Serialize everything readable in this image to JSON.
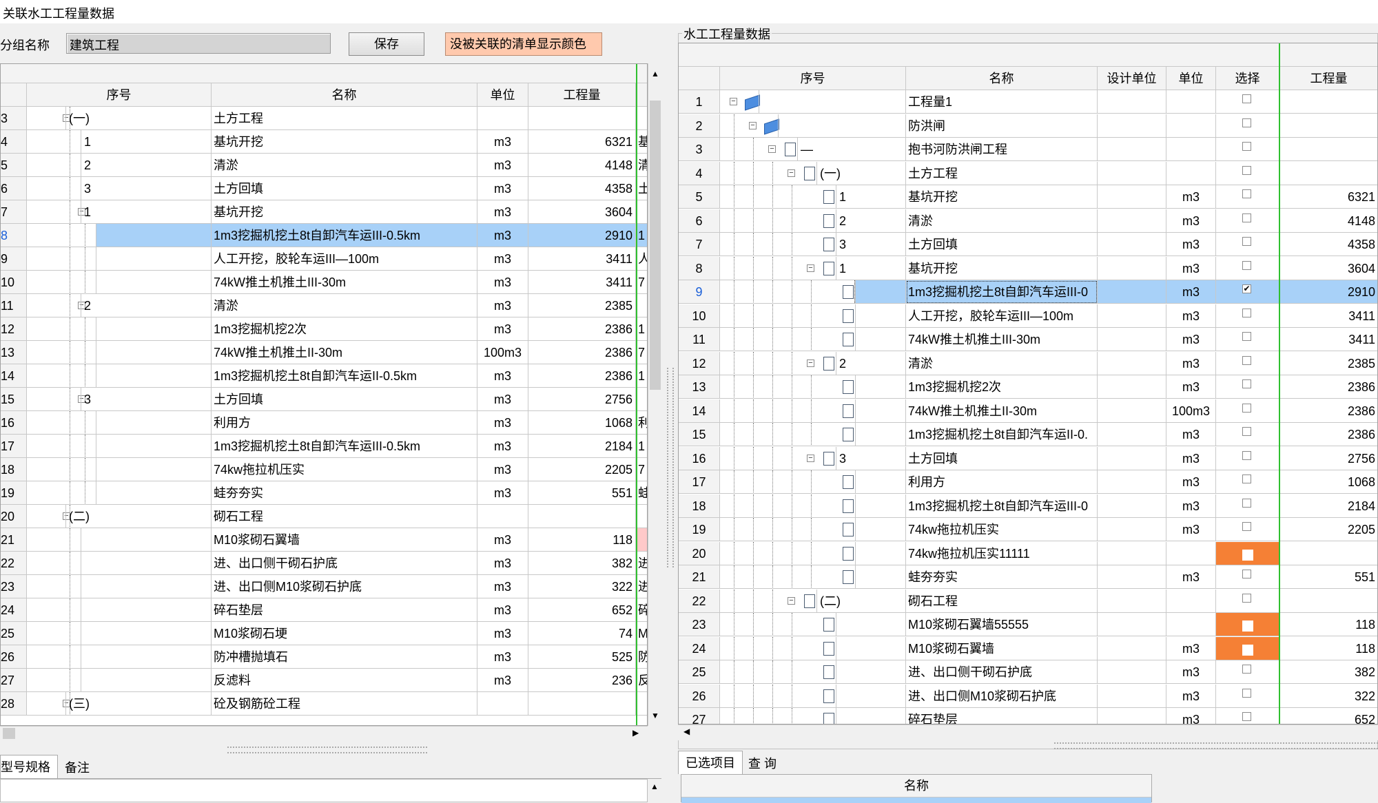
{
  "title": "关联水工工程量数据",
  "left_panel": {
    "group_label": "分组名称",
    "group_value": "建筑工程",
    "save_label": "保存",
    "color_label": "没被关联的清单显示颜色",
    "columns": [
      "序号",
      "名称",
      "单位",
      "工程量"
    ],
    "rows": [
      {
        "n": "3",
        "seq": "(一)",
        "name": "土方工程",
        "unit": "",
        "qty": "",
        "extra": "",
        "lvl": 0,
        "tog": true
      },
      {
        "n": "4",
        "seq": "1",
        "name": "基坑开挖",
        "unit": "m3",
        "qty": "6321",
        "extra": "基",
        "lvl": 1
      },
      {
        "n": "5",
        "seq": "2",
        "name": "清淤",
        "unit": "m3",
        "qty": "4148",
        "extra": "清",
        "lvl": 1
      },
      {
        "n": "6",
        "seq": "3",
        "name": "土方回填",
        "unit": "m3",
        "qty": "4358",
        "extra": "土",
        "lvl": 1
      },
      {
        "n": "7",
        "seq": "1",
        "name": "基坑开挖",
        "unit": "m3",
        "qty": "3604",
        "extra": "",
        "lvl": 1,
        "tog": true
      },
      {
        "n": "8",
        "seq": "",
        "name": "1m3挖掘机挖土8t自卸汽车运III-0.5km",
        "unit": "m3",
        "qty": "2910",
        "extra": "1",
        "lvl": 2,
        "selected": true
      },
      {
        "n": "9",
        "seq": "",
        "name": "人工开挖，胶轮车运III—100m",
        "unit": "m3",
        "qty": "3411",
        "extra": "人",
        "lvl": 2
      },
      {
        "n": "10",
        "seq": "",
        "name": "74kW推土机推土III-30m",
        "unit": "m3",
        "qty": "3411",
        "extra": "7",
        "lvl": 2
      },
      {
        "n": "11",
        "seq": "2",
        "name": "清淤",
        "unit": "m3",
        "qty": "2385",
        "extra": "",
        "lvl": 1,
        "tog": true
      },
      {
        "n": "12",
        "seq": "",
        "name": "1m3挖掘机挖2次",
        "unit": "m3",
        "qty": "2386",
        "extra": "1",
        "lvl": 2
      },
      {
        "n": "13",
        "seq": "",
        "name": "74kW推土机推土II-30m",
        "unit": "100m3",
        "qty": "2386",
        "extra": "7",
        "lvl": 2
      },
      {
        "n": "14",
        "seq": "",
        "name": "1m3挖掘机挖土8t自卸汽车运II-0.5km",
        "unit": "m3",
        "qty": "2386",
        "extra": "1",
        "lvl": 2
      },
      {
        "n": "15",
        "seq": "3",
        "name": "土方回填",
        "unit": "m3",
        "qty": "2756",
        "extra": "",
        "lvl": 1,
        "tog": true
      },
      {
        "n": "16",
        "seq": "",
        "name": "利用方",
        "unit": "m3",
        "qty": "1068",
        "extra": "利",
        "lvl": 2
      },
      {
        "n": "17",
        "seq": "",
        "name": "1m3挖掘机挖土8t自卸汽车运III-0.5km",
        "unit": "m3",
        "qty": "2184",
        "extra": "1",
        "lvl": 2
      },
      {
        "n": "18",
        "seq": "",
        "name": "74kw拖拉机压实",
        "unit": "m3",
        "qty": "2205",
        "extra": "7",
        "lvl": 2
      },
      {
        "n": "19",
        "seq": "",
        "name": "蛙夯夯实",
        "unit": "m3",
        "qty": "551",
        "extra": "蛙",
        "lvl": 2
      },
      {
        "n": "20",
        "seq": "(二)",
        "name": "砌石工程",
        "unit": "",
        "qty": "",
        "extra": "",
        "lvl": 0,
        "tog": true
      },
      {
        "n": "21",
        "seq": "",
        "name": "M10浆砌石翼墙",
        "unit": "m3",
        "qty": "118",
        "extra": "",
        "lvl": 1,
        "pink": true
      },
      {
        "n": "22",
        "seq": "",
        "name": "进、出口侧干砌石护底",
        "unit": "m3",
        "qty": "382",
        "extra": "进",
        "lvl": 1
      },
      {
        "n": "23",
        "seq": "",
        "name": "进、出口侧M10浆砌石护底",
        "unit": "m3",
        "qty": "322",
        "extra": "进",
        "lvl": 1
      },
      {
        "n": "24",
        "seq": "",
        "name": "碎石垫层",
        "unit": "m3",
        "qty": "652",
        "extra": "碎",
        "lvl": 1
      },
      {
        "n": "25",
        "seq": "",
        "name": "M10浆砌石埂",
        "unit": "m3",
        "qty": "74",
        "extra": "M",
        "lvl": 1
      },
      {
        "n": "26",
        "seq": "",
        "name": "防冲槽抛填石",
        "unit": "m3",
        "qty": "525",
        "extra": "防",
        "lvl": 1
      },
      {
        "n": "27",
        "seq": "",
        "name": "反滤料",
        "unit": "m3",
        "qty": "236",
        "extra": "反",
        "lvl": 1
      },
      {
        "n": "28",
        "seq": "(三)",
        "name": "砼及钢筋砼工程",
        "unit": "",
        "qty": "",
        "extra": "",
        "lvl": 0,
        "tog": true
      }
    ],
    "tabs": [
      "型号规格",
      "备注"
    ]
  },
  "right_panel": {
    "group_title": "水工工程量数据",
    "columns": [
      "序号",
      "名称",
      "设计单位",
      "单位",
      "选择",
      "工程量"
    ],
    "rows": [
      {
        "n": "1",
        "seq": "",
        "name": "工程量1",
        "unit": "",
        "qty": "",
        "lvl": 0,
        "icon": "book",
        "tog": true,
        "check": false
      },
      {
        "n": "2",
        "seq": "",
        "name": "防洪闸",
        "unit": "",
        "qty": "",
        "lvl": 1,
        "icon": "book",
        "tog": true,
        "check": false
      },
      {
        "n": "3",
        "seq": "—",
        "name": "抱书河防洪闸工程",
        "unit": "",
        "qty": "",
        "lvl": 2,
        "icon": "doc",
        "tog": true,
        "check": false
      },
      {
        "n": "4",
        "seq": "(一)",
        "name": "土方工程",
        "unit": "",
        "qty": "",
        "lvl": 3,
        "icon": "doc",
        "tog": true,
        "check": false
      },
      {
        "n": "5",
        "seq": "1",
        "name": "基坑开挖",
        "unit": "m3",
        "qty": "6321",
        "lvl": 4,
        "icon": "doc",
        "check": false
      },
      {
        "n": "6",
        "seq": "2",
        "name": "清淤",
        "unit": "m3",
        "qty": "4148",
        "lvl": 4,
        "icon": "doc",
        "check": false
      },
      {
        "n": "7",
        "seq": "3",
        "name": "土方回填",
        "unit": "m3",
        "qty": "4358",
        "lvl": 4,
        "icon": "doc",
        "check": false
      },
      {
        "n": "8",
        "seq": "1",
        "name": "基坑开挖",
        "unit": "m3",
        "qty": "3604",
        "lvl": 4,
        "icon": "doc",
        "tog": true,
        "check": false
      },
      {
        "n": "9",
        "seq": "",
        "name": "1m3挖掘机挖土8t自卸汽车运III-0",
        "unit": "m3",
        "qty": "2910",
        "lvl": 5,
        "icon": "doc",
        "check": true,
        "selected": true
      },
      {
        "n": "10",
        "seq": "",
        "name": "人工开挖，胶轮车运III—100m",
        "unit": "m3",
        "qty": "3411",
        "lvl": 5,
        "icon": "doc",
        "check": false
      },
      {
        "n": "11",
        "seq": "",
        "name": "74kW推土机推土III-30m",
        "unit": "m3",
        "qty": "3411",
        "lvl": 5,
        "icon": "doc",
        "check": false
      },
      {
        "n": "12",
        "seq": "2",
        "name": "清淤",
        "unit": "m3",
        "qty": "2385",
        "lvl": 4,
        "icon": "doc",
        "tog": true,
        "check": false
      },
      {
        "n": "13",
        "seq": "",
        "name": "1m3挖掘机挖2次",
        "unit": "m3",
        "qty": "2386",
        "lvl": 5,
        "icon": "doc",
        "check": false
      },
      {
        "n": "14",
        "seq": "",
        "name": "74kW推土机推土II-30m",
        "unit": "100m3",
        "qty": "2386",
        "lvl": 5,
        "icon": "doc",
        "check": false
      },
      {
        "n": "15",
        "seq": "",
        "name": "1m3挖掘机挖土8t自卸汽车运II-0.",
        "unit": "m3",
        "qty": "2386",
        "lvl": 5,
        "icon": "doc",
        "check": false
      },
      {
        "n": "16",
        "seq": "3",
        "name": "土方回填",
        "unit": "m3",
        "qty": "2756",
        "lvl": 4,
        "icon": "doc",
        "tog": true,
        "check": false
      },
      {
        "n": "17",
        "seq": "",
        "name": "利用方",
        "unit": "m3",
        "qty": "1068",
        "lvl": 5,
        "icon": "doc",
        "check": false
      },
      {
        "n": "18",
        "seq": "",
        "name": "1m3挖掘机挖土8t自卸汽车运III-0",
        "unit": "m3",
        "qty": "2184",
        "lvl": 5,
        "icon": "doc",
        "check": false
      },
      {
        "n": "19",
        "seq": "",
        "name": "74kw拖拉机压实",
        "unit": "m3",
        "qty": "2205",
        "lvl": 5,
        "icon": "doc",
        "check": false
      },
      {
        "n": "20",
        "seq": "",
        "name": "74kw拖拉机压实11111",
        "unit": "",
        "qty": "",
        "lvl": 5,
        "icon": "doc",
        "check": false,
        "orange": true
      },
      {
        "n": "21",
        "seq": "",
        "name": "蛙夯夯实",
        "unit": "m3",
        "qty": "551",
        "lvl": 5,
        "icon": "doc",
        "check": false
      },
      {
        "n": "22",
        "seq": "(二)",
        "name": "砌石工程",
        "unit": "",
        "qty": "",
        "lvl": 3,
        "icon": "doc",
        "tog": true,
        "check": false
      },
      {
        "n": "23",
        "seq": "",
        "name": "M10浆砌石翼墙55555",
        "unit": "",
        "qty": "118",
        "lvl": 4,
        "icon": "doc",
        "check": false,
        "orange": true
      },
      {
        "n": "24",
        "seq": "",
        "name": "M10浆砌石翼墙",
        "unit": "m3",
        "qty": "118",
        "lvl": 4,
        "icon": "doc",
        "check": false,
        "orange": true
      },
      {
        "n": "25",
        "seq": "",
        "name": "进、出口侧干砌石护底",
        "unit": "m3",
        "qty": "382",
        "lvl": 4,
        "icon": "doc",
        "check": false
      },
      {
        "n": "26",
        "seq": "",
        "name": "进、出口侧M10浆砌石护底",
        "unit": "m3",
        "qty": "322",
        "lvl": 4,
        "icon": "doc",
        "check": false
      },
      {
        "n": "27",
        "seq": "",
        "name": "碎石垫层",
        "unit": "m3",
        "qty": "652",
        "lvl": 4,
        "icon": "doc",
        "check": false
      }
    ],
    "tabs": [
      "已选项目",
      "查 询"
    ],
    "bottom_column": "名称"
  },
  "colors": {
    "selected_row": "#a8d1f8",
    "unlinked": "#f58035",
    "color_button": "#ffc9ad",
    "guide_line": "#2fc02f",
    "row_number_active": "#1a5fd8"
  }
}
